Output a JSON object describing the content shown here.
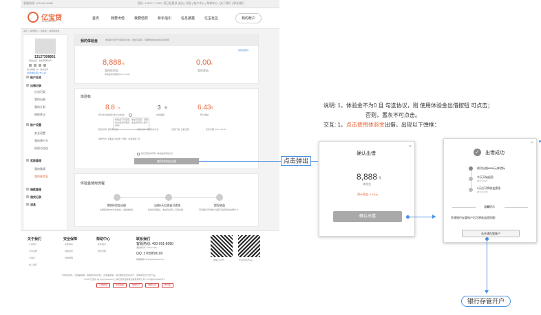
{
  "topbar": {
    "left": "客服热线: 400-091-8080",
    "right": "您好, 13127****3321 您已经登录 退出 | 消息 | 账户中心 | 帮助中心 | 关于我们 | 联系我们"
  },
  "header": {
    "logo": "亿宝贷",
    "logo_sub": "ebao-loan.com",
    "nav": [
      "首页",
      "我要出借",
      "我要借款",
      "新手指引",
      "信息披露",
      "亿宝社区"
    ],
    "account_btn": "我的账户"
  },
  "breadcrumb": "首页 > 我的账户 > 体验金 > 我的体验金",
  "sidebar": {
    "phone": "13127308661",
    "user_line": "我是会员 · 最后登录时间",
    "cert_line": "安全等级: 中 · 我的证件",
    "links": "[我的邀请码] [去认证]",
    "groups": [
      {
        "head": "账户总览",
        "items": []
      },
      {
        "head": "出借记录",
        "items": [
          "红包记录",
          "我的出借",
          "我的计划",
          "债权转让"
        ]
      },
      {
        "head": "账户设置",
        "items": [
          "安全设置",
          "我的银行卡",
          "授权与协议"
        ]
      },
      {
        "head": "奖励管理",
        "items": [
          "我的邀请",
          "我的体验金"
        ]
      },
      {
        "head": "借款管理",
        "items": []
      },
      {
        "head": "借贷记录",
        "items": []
      },
      {
        "head": "消息",
        "items": []
      }
    ]
  },
  "summary": {
    "title": "我的体验金",
    "desc": "体验金可用于出借指定标的，收益可提现，到期体验金本金将自动收回",
    "link": "体验金规则",
    "amount": "8,888",
    "amount_unit": "元",
    "amount_label": "我的体验金",
    "expire": "体验金有效期至2017-10-30",
    "income": "0.00",
    "income_unit": "元",
    "income_label": "我的收益"
  },
  "product": {
    "title": "体验标",
    "rate": "8.8",
    "rate_unit": "%",
    "rate_label": "预计年化收益率(含平台奖励)",
    "term": "3",
    "term_unit": "天",
    "term_label": "出借期限",
    "profit": "6.43",
    "profit_unit": "元",
    "profit_label": "预计收益",
    "tooltip": "体验金不可提现，收益可提现；到期后本金自动收回，收益自动转入账户余额。",
    "info": [
      "起息时间: 满标即计息",
      "还款方式: 到期还本付息",
      "出借门槛: 全额出借",
      "还款日期: 2017-10-30"
    ],
    "risk": "保障方式: 到期后平台统一回购 · 风险等级: 低",
    "agree": "我已阅读并同意《体验金使用协议》",
    "invest_btn": "使用体验金出借"
  },
  "flow": {
    "title": "体验金使用流程",
    "steps": [
      {
        "name": "领取体验金出借",
        "desc": "注册即送8888元体验金，出借体验标"
      },
      {
        "name": "出借3天后收益可提现",
        "desc": "体验标到期后，收益自动转入可用余额"
      },
      {
        "name": "提现收益",
        "desc": "开通银行存管账户后即可提现到您的银行卡"
      }
    ]
  },
  "footer": {
    "cols": [
      {
        "title": "关于我们",
        "items": [
          "公司简介",
          "平台资质",
          "大事记",
          "加入我们"
        ]
      },
      {
        "title": "安全保障",
        "items": [
          "风控体系",
          "资金存管",
          "法律保障"
        ]
      },
      {
        "title": "帮助中心",
        "items": [
          "新手指引",
          "常见问题"
        ]
      }
    ],
    "contact_title": "联系我们",
    "hotline": "客服热线: 400-091-8080",
    "hours": "(服务时间: 9:00-21:00)",
    "qq": "QQ: 2765858100",
    "email": "客服邮箱: kefu@091bank.com",
    "qr1": "微信公众号",
    "qr2": "亿宝贷官方App",
    "legal1": "市场有风险，出借需谨慎。网络借贷有风险，出借需谨慎，请合理配置您的资产，选择适合自己的产品。",
    "legal2": "©2017亿宝贷 All rights reserved 上海亿宝贷金融信息服务有限公司 | ICP备16029110号-1",
    "badges": [
      "可信网站",
      "安全联盟",
      "网警110",
      "诚信认证",
      "支付宝"
    ]
  },
  "annotation": {
    "line1": "说明: 1，体验金不为0 且 勾选协议，则 使用体验金出借按钮 可点击；",
    "line2": "否则，置灰不可点击。",
    "line3_prefix": "交互: 1，",
    "line3_link": "点击使用体验金",
    "line3_suffix": "出借，出现以下弹框："
  },
  "click_label": "点击弹出",
  "confirm_modal": {
    "title": "确认出借",
    "amount": "8,888",
    "unit": "元",
    "amount_label": "体验金",
    "profit": "预计收益: 6.43元",
    "button": "确认出借",
    "close": "×"
  },
  "success_modal": {
    "title": "出借成功",
    "close": "×",
    "steps": [
      {
        "name": "成功出借8888元体验标",
        "date": ""
      },
      {
        "name": "今天开始起息",
        "date": "2017-10-27"
      },
      {
        "name": "3天后可将收益提现",
        "date": "2017-10-30"
      }
    ],
    "tip_title": "温馨提示",
    "tip": "开通银行存管账户后可将收益提现哦~",
    "button": "去开通存管账户"
  },
  "bank_label": "银行存管开户",
  "colors": {
    "accent": "#e8643a",
    "link": "#4a90e2",
    "button_gray": "#a9a9a9"
  }
}
